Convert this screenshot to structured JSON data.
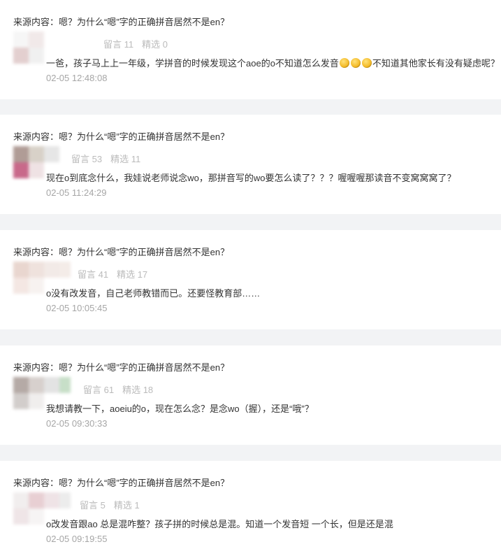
{
  "items": [
    {
      "source": "来源内容：嗯？为什么“嗯”字的正确拼音居然不是en？",
      "stats": {
        "comments": "留言 11",
        "featured": "精选 0"
      },
      "comment_before": "一爸，孩子马上上一年级，学拼音的时候发现这个aoe的o不知道怎么发音",
      "emojis": [
        "facepalm-emoji",
        "facepalm-emoji",
        "facepalm-emoji"
      ],
      "comment_after": "不知道其他家长有没有疑虑呢？",
      "time": "02-05 12:48:08",
      "avatar_colors": [
        "#f6f6f6",
        "#f1e9e9",
        "#ffffff",
        "#ffffff",
        "#e3cfcf",
        "#f0f0f0",
        "#ffffff",
        "#ffffff"
      ]
    },
    {
      "source": "来源内容：嗯？为什么“嗯”字的正确拼音居然不是en？",
      "stats": {
        "comments": "留言 53",
        "featured": "精选 11"
      },
      "comment_before": "现在o到底念什么，我娃说老师说念wo，那拼音写的wo要怎么读了？？？喔喔喔那读音不变窝窝窝了？",
      "emojis": [],
      "comment_after": "",
      "time": "02-05 11:24:29",
      "avatar_colors": [
        "#b09c96",
        "#d8d1c8",
        "#e6e6e6",
        "#ffffff",
        "#c8698a",
        "#efe2e4",
        "#ffffff",
        "#ffffff"
      ]
    },
    {
      "source": "来源内容：嗯？为什么“嗯”字的正确拼音居然不是en？",
      "stats": {
        "comments": "留言 41",
        "featured": "精选 17"
      },
      "comment_before": "o没有改发音，自己老师教错而已。还要怪教育部……",
      "emojis": [],
      "comment_after": "",
      "time": "02-05 10:05:45",
      "avatar_colors": [
        "#e9d6cf",
        "#efe2dd",
        "#f2eae7",
        "#f4ece8",
        "#f4e7e3",
        "#f7f2f0",
        "#ffffff",
        "#ffffff"
      ]
    },
    {
      "source": "来源内容：嗯？为什么“嗯”字的正确拼音居然不是en？",
      "stats": {
        "comments": "留言 61",
        "featured": "精选 18"
      },
      "comment_before": "我想请教一下，aoeiu的o，现在怎么念？是念wo（握），还是“哦”？",
      "emojis": [],
      "comment_after": "",
      "time": "02-05 09:30:33",
      "avatar_colors": [
        "#b5aaa6",
        "#d7d0cd",
        "#e3e3e3",
        "#c7dfc8",
        "#d2cdcb",
        "#f0eeed",
        "#ffffff",
        "#ffffff"
      ]
    },
    {
      "source": "来源内容：嗯？为什么“嗯”字的正确拼音居然不是en？",
      "stats": {
        "comments": "留言 5",
        "featured": "精选 1"
      },
      "comment_before": "o改发音跟ao 总是混咋整？孩子拼的时候总是混。知道一个发音短 一个长，但是还是混",
      "emojis": [],
      "comment_after": "",
      "time": "02-05 09:19:55",
      "avatar_colors": [
        "#f1eeee",
        "#e8cfd3",
        "#efe3e6",
        "#ececec",
        "#efe5e7",
        "#f6f4f4",
        "#ffffff",
        "#ffffff"
      ]
    }
  ]
}
